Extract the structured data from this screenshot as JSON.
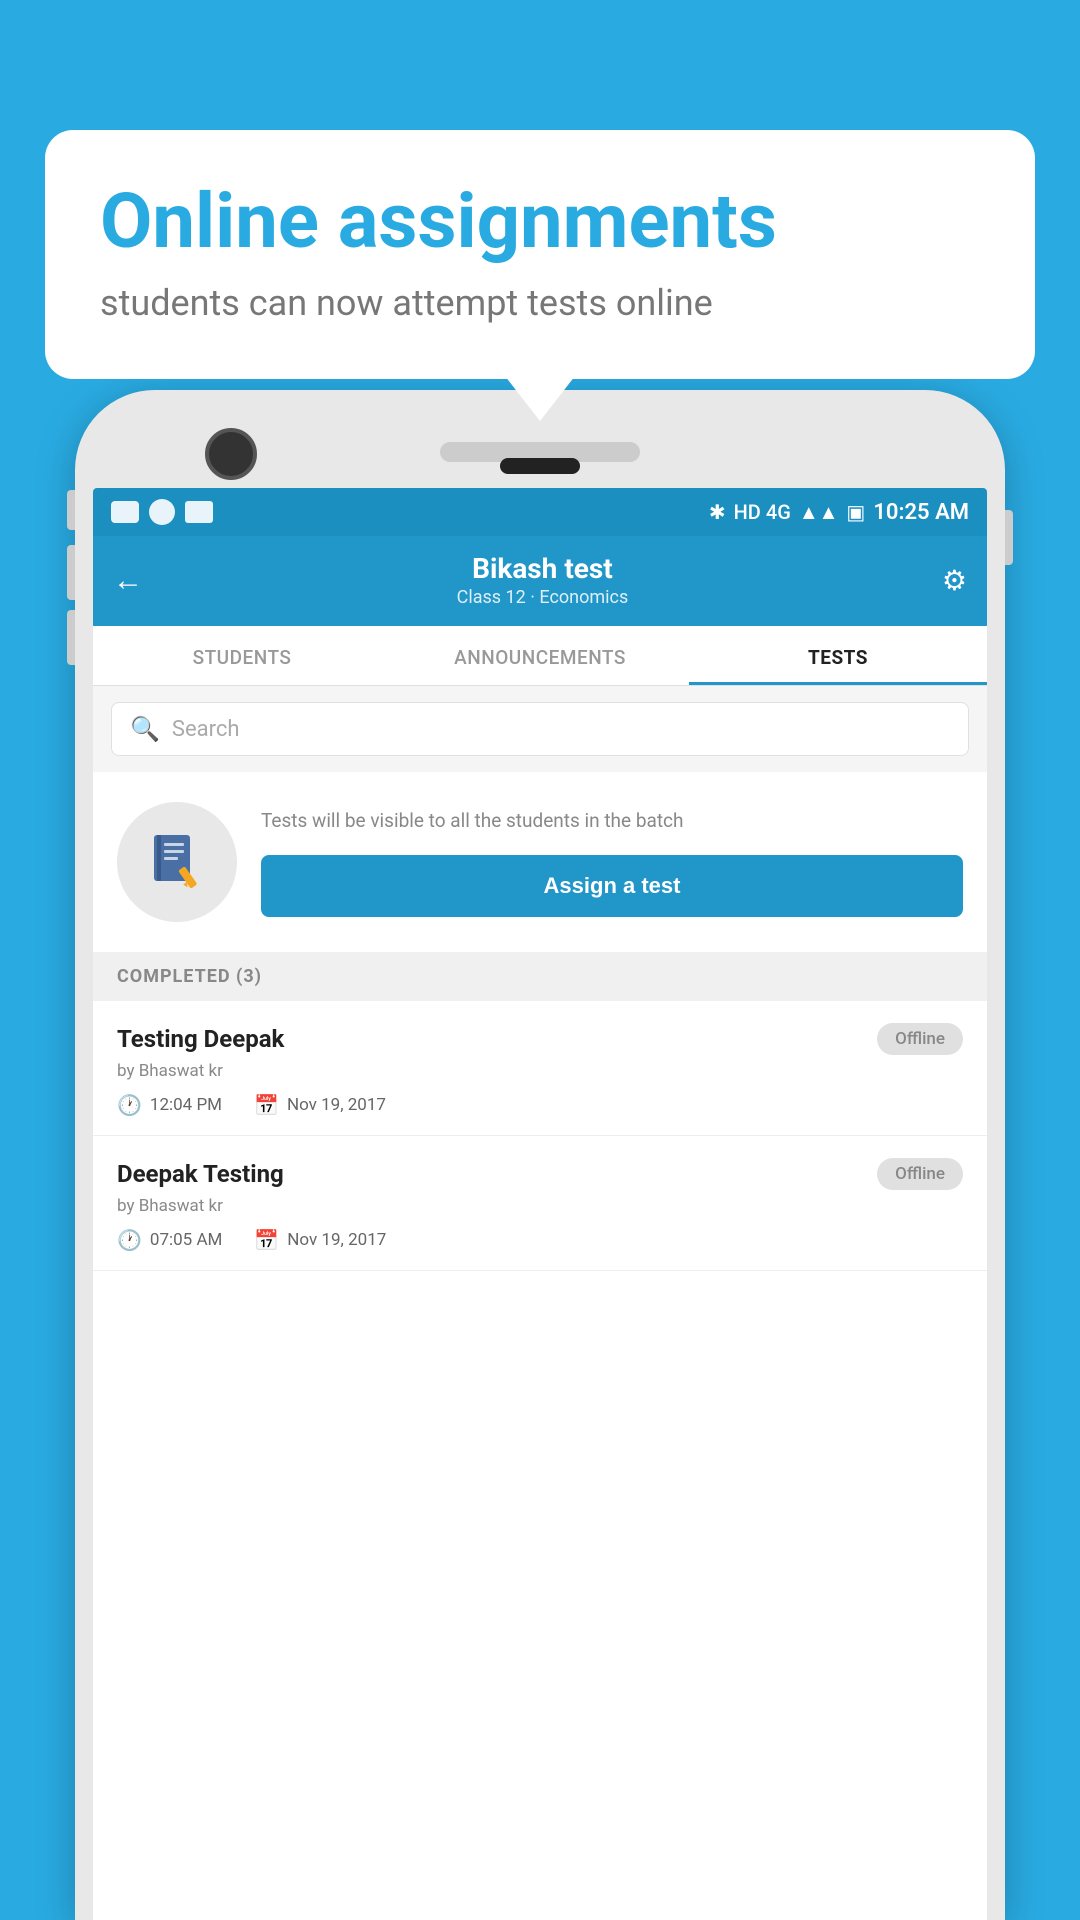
{
  "background": {
    "color": "#29ABE2"
  },
  "speech_bubble": {
    "title": "Online assignments",
    "subtitle": "students can now attempt tests online"
  },
  "status_bar": {
    "time": "10:25 AM",
    "signal_text": "HD 4G"
  },
  "header": {
    "title": "Bikash test",
    "subtitle": "Class 12 · Economics",
    "back_label": "←",
    "settings_label": "⚙"
  },
  "tabs": [
    {
      "label": "STUDENTS",
      "active": false
    },
    {
      "label": "ANNOUNCEMENTS",
      "active": false
    },
    {
      "label": "TESTS",
      "active": true
    }
  ],
  "search": {
    "placeholder": "Search"
  },
  "assign_section": {
    "info_text": "Tests will be visible to all the students in the batch",
    "button_label": "Assign a test"
  },
  "completed_section": {
    "header": "COMPLETED (3)",
    "items": [
      {
        "name": "Testing Deepak",
        "author": "by Bhaswat kr",
        "time": "12:04 PM",
        "date": "Nov 19, 2017",
        "status": "Offline"
      },
      {
        "name": "Deepak Testing",
        "author": "by Bhaswat kr",
        "time": "07:05 AM",
        "date": "Nov 19, 2017",
        "status": "Offline"
      }
    ]
  }
}
